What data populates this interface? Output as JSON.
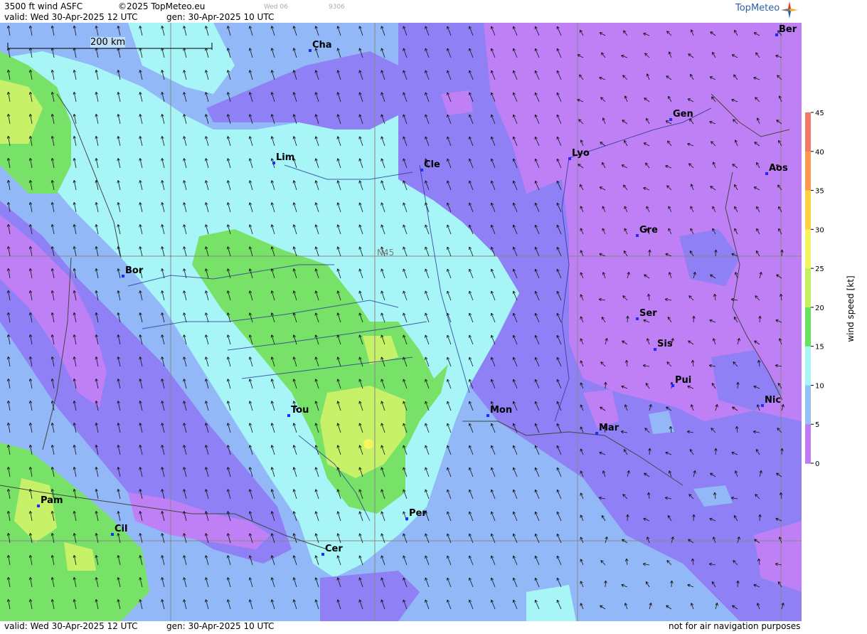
{
  "header": {
    "title": "3500 ft wind ASFC",
    "copyright": "©2025 TopMeteo.eu",
    "tab_faint": "Wed 06",
    "code_faint": "9306",
    "valid": "valid:  Wed  30-Apr-2025  12 UTC",
    "gen": "gen: 30-Apr-2025 10 UTC"
  },
  "logo_text": "TopMeteo",
  "scale_label": "200 km",
  "graticule_label": "N45",
  "cities": [
    {
      "code": "Cha"
    },
    {
      "code": "Lim"
    },
    {
      "code": "Cle"
    },
    {
      "code": "Lyo"
    },
    {
      "code": "Gen"
    },
    {
      "code": "Ber"
    },
    {
      "code": "Aos"
    },
    {
      "code": "Gre"
    },
    {
      "code": "Bor"
    },
    {
      "code": "Ser"
    },
    {
      "code": "Sis"
    },
    {
      "code": "Pui"
    },
    {
      "code": "Nic"
    },
    {
      "code": "Tou"
    },
    {
      "code": "Mon"
    },
    {
      "code": "Mar"
    },
    {
      "code": "Pam"
    },
    {
      "code": "Cil"
    },
    {
      "code": "Per"
    },
    {
      "code": "Cer"
    }
  ],
  "footer": {
    "valid": "valid:  Wed  30-Apr-2025  12 UTC",
    "gen": "gen: 30-Apr-2025 10 UTC",
    "disclaimer": "not for air navigation purposes"
  },
  "legend": {
    "label": "wind  speed  [kt]",
    "ticks": [
      "45",
      "40",
      "35",
      "30",
      "25",
      "20",
      "15",
      "10",
      "5",
      "0"
    ],
    "colors": [
      "#f07a6a",
      "#ff9a50",
      "#ffd040",
      "#f2f560",
      "#c4f060",
      "#68e060",
      "#a8f5f5",
      "#94c0f8",
      "#8f87f4",
      "#c07af4"
    ]
  },
  "palette": {
    "purple": "#bf7ff5",
    "violet": "#9080f5",
    "blue": "#92b8f7",
    "cyan": "#a8f5f7",
    "green": "#78e268",
    "lime": "#c7f168",
    "yellow": "#f5f560"
  }
}
